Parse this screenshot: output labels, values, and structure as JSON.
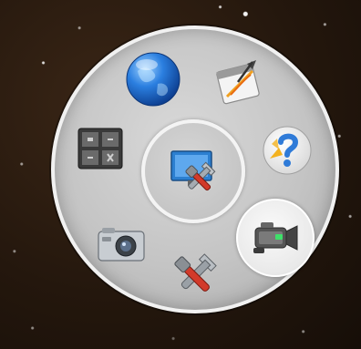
{
  "menu": {
    "center": {
      "icon": "system-preferences-icon"
    },
    "items": [
      {
        "icon": "globe-icon",
        "selected": false
      },
      {
        "icon": "pen-and-paper-icon",
        "selected": false
      },
      {
        "icon": "help-icon",
        "selected": false
      },
      {
        "icon": "video-camera-icon",
        "selected": true
      },
      {
        "icon": "tools-icon",
        "selected": false
      },
      {
        "icon": "photo-camera-icon",
        "selected": false
      },
      {
        "icon": "calculator-icon",
        "selected": false
      }
    ]
  },
  "colors": {
    "background": "#24170d",
    "ring": "#c4c4c4",
    "ring_border": "#f1f1f1",
    "globe_blue": "#1f6fd6",
    "tool_red": "#d23a2a",
    "screen_blue": "#2c7fd0"
  }
}
